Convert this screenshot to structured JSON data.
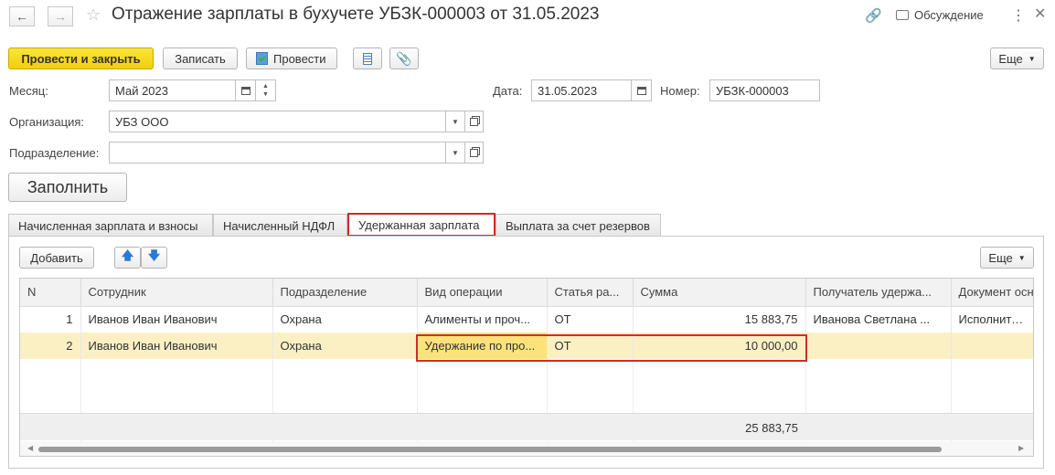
{
  "window": {
    "title": "Отражение зарплаты в бухучете УБЗК-000003 от 31.05.2023",
    "discussion_label": "Обсуждение"
  },
  "toolbar": {
    "post_close_label": "Провести и закрыть",
    "save_label": "Записать",
    "post_label": "Провести",
    "more_label": "Еще"
  },
  "form": {
    "month_label": "Месяц:",
    "month_value": "Май 2023",
    "date_label": "Дата:",
    "date_value": "31.05.2023",
    "number_label": "Номер:",
    "number_value": "УБЗК-000003",
    "org_label": "Организация:",
    "org_value": "УБЗ ООО",
    "dept_label": "Подразделение:",
    "dept_value": "",
    "fill_label": "Заполнить"
  },
  "tabs": [
    {
      "label": "Начисленная зарплата и взносы",
      "active": false
    },
    {
      "label": "Начисленный НДФЛ",
      "active": false
    },
    {
      "label": "Удержанная зарплата",
      "active": true
    },
    {
      "label": "Выплата за счет резервов",
      "active": false
    }
  ],
  "table_toolbar": {
    "add_label": "Добавить",
    "more_label": "Еще"
  },
  "table": {
    "columns": [
      "N",
      "Сотрудник",
      "Подразделение",
      "Вид операции",
      "Статья ра...",
      "Сумма",
      "Получатель удержа...",
      "Документ осн"
    ],
    "rows": [
      [
        "1",
        "Иванов Иван Иванович",
        "Охрана",
        "Алименты и проч...",
        "ОТ",
        "15 883,75",
        "Иванова Светлана ...",
        "Исполнителы"
      ],
      [
        "2",
        "Иванов Иван Иванович",
        "Охрана",
        "Удержание по про...",
        "ОТ",
        "10 000,00",
        "",
        ""
      ]
    ],
    "total_sum": "25 883,75"
  },
  "colors": {
    "accent_yellow": "#f2cf0b",
    "highlight_red": "#d42a2a",
    "selected_row": "#fbf0c4"
  }
}
